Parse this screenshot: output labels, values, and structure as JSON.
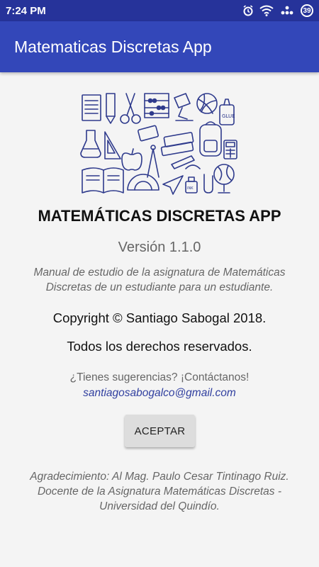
{
  "status": {
    "time": "7:24 PM",
    "battery": "39",
    "icons": [
      "alarm-icon",
      "wifi-icon",
      "signal-dots-icon",
      "battery-icon"
    ]
  },
  "app_bar": {
    "title": "Matematicas Discretas App"
  },
  "illustration": {
    "name": "school-supplies-illustration",
    "color": "#2e3a8c"
  },
  "about": {
    "title": "MATEMÁTICAS DISCRETAS APP",
    "version": "Versión 1.1.0",
    "description": "Manual de estudio de la asignatura de Matemáticas Discretas de un estudiante para un estudiante.",
    "copyright": "Copyright © Santiago Sabogal 2018.",
    "rights": "Todos los derechos reservados.",
    "suggestions": "¿Tienes sugerencias? ¡Contáctanos!",
    "email": "santiagosabogalco@gmail.com",
    "accept_label": "ACEPTAR",
    "thanks_line1": "Agradecimiento: Al Mag. Paulo Cesar Tintinago Ruiz.",
    "thanks_line2": "Docente de la Asignatura Matemáticas Discretas -",
    "thanks_line3": "Universidad del Quindío."
  },
  "colors": {
    "status_bar": "#26339a",
    "app_bar": "#3347b9",
    "background": "#f4f4f4",
    "link": "#303f9f",
    "button": "#dddddd"
  }
}
